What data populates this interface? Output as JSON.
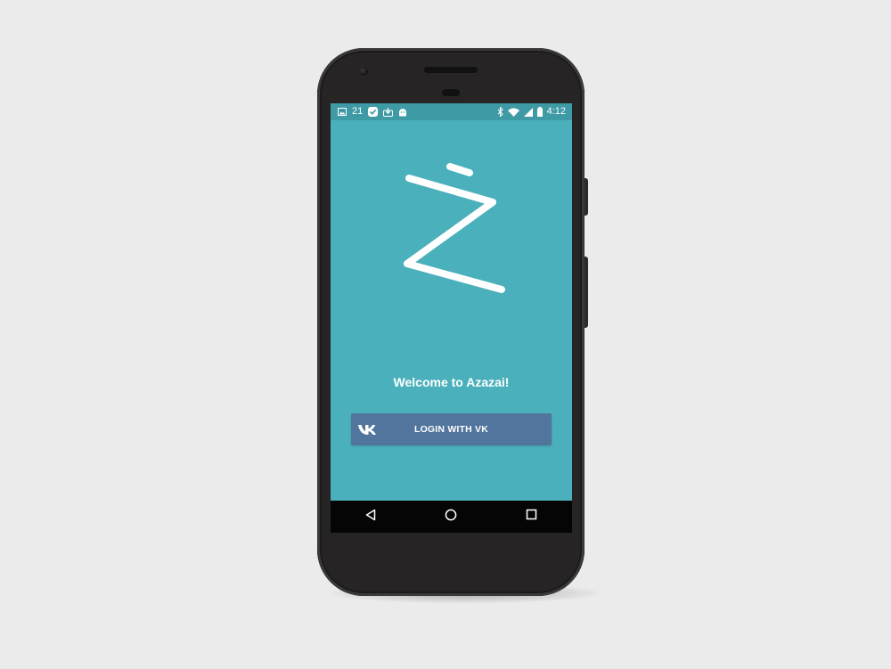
{
  "status_bar": {
    "notification_count": "21",
    "time": "4:12",
    "left_icons": [
      "image-icon",
      "check-icon",
      "download-icon",
      "android-icon"
    ],
    "right_icons": [
      "bluetooth-icon",
      "wifi-icon",
      "signal-icon",
      "battery-icon"
    ]
  },
  "app": {
    "logo_name": "azazai-logo",
    "welcome_text": "Welcome to Azazai!",
    "login_button_label": "LOGIN WITH VK",
    "login_button_icon": "vk-icon"
  },
  "nav_bar": {
    "buttons": [
      "back-icon",
      "home-icon",
      "recents-icon"
    ]
  },
  "colors": {
    "screen_bg": "#4ab0bb",
    "status_bar_bg": "#3e9aa4",
    "vk_button_bg": "#52759e",
    "nav_bar_bg": "#050505",
    "phone_body": "#262424",
    "background": "#ebebeb"
  }
}
